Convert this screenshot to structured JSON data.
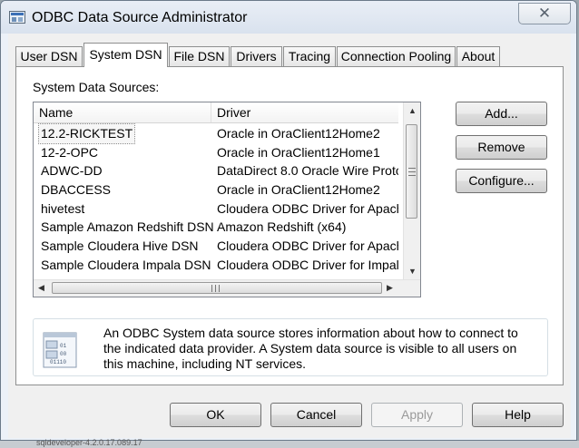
{
  "window": {
    "title": "ODBC Data Source Administrator",
    "close_glyph": "✕"
  },
  "tabs": [
    "User DSN",
    "System DSN",
    "File DSN",
    "Drivers",
    "Tracing",
    "Connection Pooling",
    "About"
  ],
  "active_tab": "System DSN",
  "system_data_sources_label": "System Data Sources:",
  "columns": {
    "name": "Name",
    "driver": "Driver"
  },
  "rows": [
    {
      "name": "12.2-RICKTEST",
      "driver": "Oracle in OraClient12Home2"
    },
    {
      "name": "12-2-OPC",
      "driver": "Oracle in OraClient12Home1"
    },
    {
      "name": "ADWC-DD",
      "driver": "DataDirect 8.0 Oracle Wire Proto"
    },
    {
      "name": "DBACCESS",
      "driver": "Oracle in OraClient12Home2"
    },
    {
      "name": "hivetest",
      "driver": "Cloudera ODBC Driver for Apach"
    },
    {
      "name": "Sample Amazon Redshift DSN",
      "driver": "Amazon Redshift (x64)"
    },
    {
      "name": "Sample Cloudera Hive DSN",
      "driver": "Cloudera ODBC Driver for Apach"
    },
    {
      "name": "Sample Cloudera Impala DSN",
      "driver": "Cloudera ODBC Driver for Impala"
    }
  ],
  "side_buttons": {
    "add": "Add...",
    "remove": "Remove",
    "configure": "Configure..."
  },
  "info_text": "An ODBC System data source stores information about how to connect to the indicated data provider.  A System data source is visible to all users on this machine, including NT services.",
  "bottom_buttons": {
    "ok": "OK",
    "cancel": "Cancel",
    "apply": "Apply",
    "help": "Help"
  },
  "background_text": "sqldeveloper-4.2.0.17.089.17"
}
